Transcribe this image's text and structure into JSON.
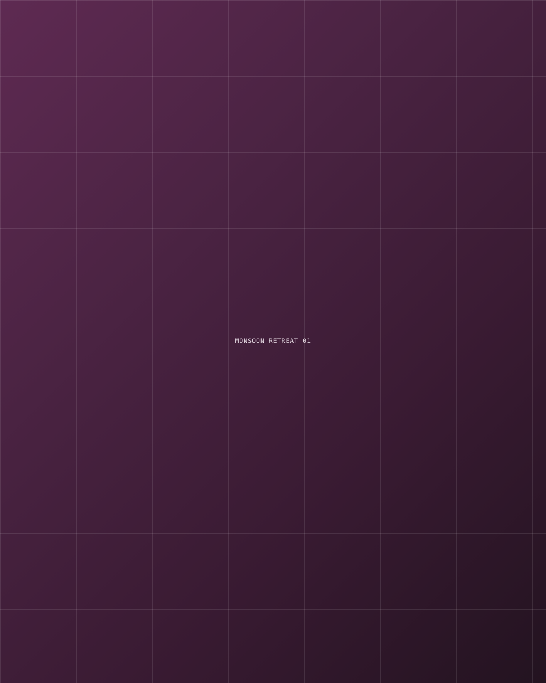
{
  "caption": {
    "text": "MONSOON RETREAT 01"
  },
  "colors": {
    "background_start": "#5e2a52",
    "background_end": "#231320",
    "text": "#f2e8f0"
  }
}
